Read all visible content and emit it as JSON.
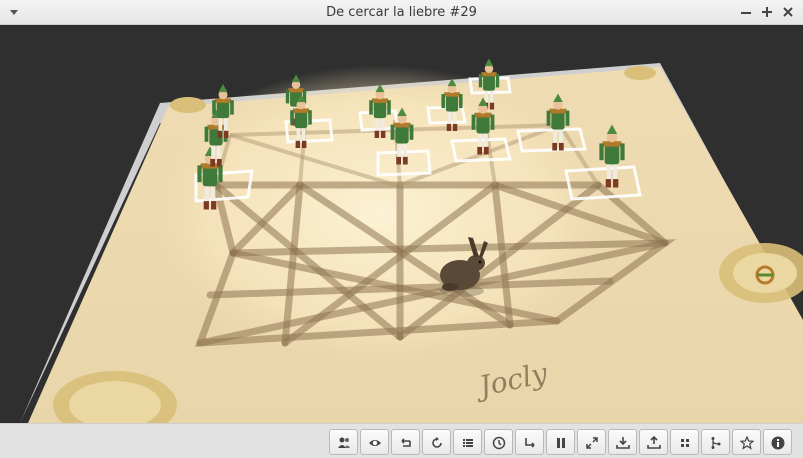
{
  "window": {
    "title": "De cercar la liebre #29"
  },
  "board": {
    "signature": "Jocly"
  },
  "pieces": {
    "hunters": 12,
    "hares": 1
  },
  "colors": {
    "board": "#f0dfb8",
    "line": "#8e7450",
    "hunter_tunic": "#3f7a3a",
    "hunter_trim": "#b07a2a",
    "hare": "#5b4938"
  },
  "toolbar": {
    "buttons": [
      {
        "name": "players-button",
        "icon": "players-icon"
      },
      {
        "name": "view-button",
        "icon": "eye-icon"
      },
      {
        "name": "undo-button",
        "icon": "undo-icon"
      },
      {
        "name": "restart-button",
        "icon": "restart-icon"
      },
      {
        "name": "moves-list-button",
        "icon": "list-icon"
      },
      {
        "name": "clock-button",
        "icon": "clock-icon"
      },
      {
        "name": "redo-button",
        "icon": "redo-icon"
      },
      {
        "name": "pause-button",
        "icon": "pause-icon"
      },
      {
        "name": "fullscreen-button",
        "icon": "fullscreen-icon"
      },
      {
        "name": "download-button",
        "icon": "download-icon"
      },
      {
        "name": "upload-button",
        "icon": "upload-icon"
      },
      {
        "name": "grid-view-button",
        "icon": "grid-icon"
      },
      {
        "name": "game-tree-button",
        "icon": "tree-icon"
      },
      {
        "name": "favorite-button",
        "icon": "star-icon"
      },
      {
        "name": "info-button",
        "icon": "info-icon"
      }
    ]
  }
}
